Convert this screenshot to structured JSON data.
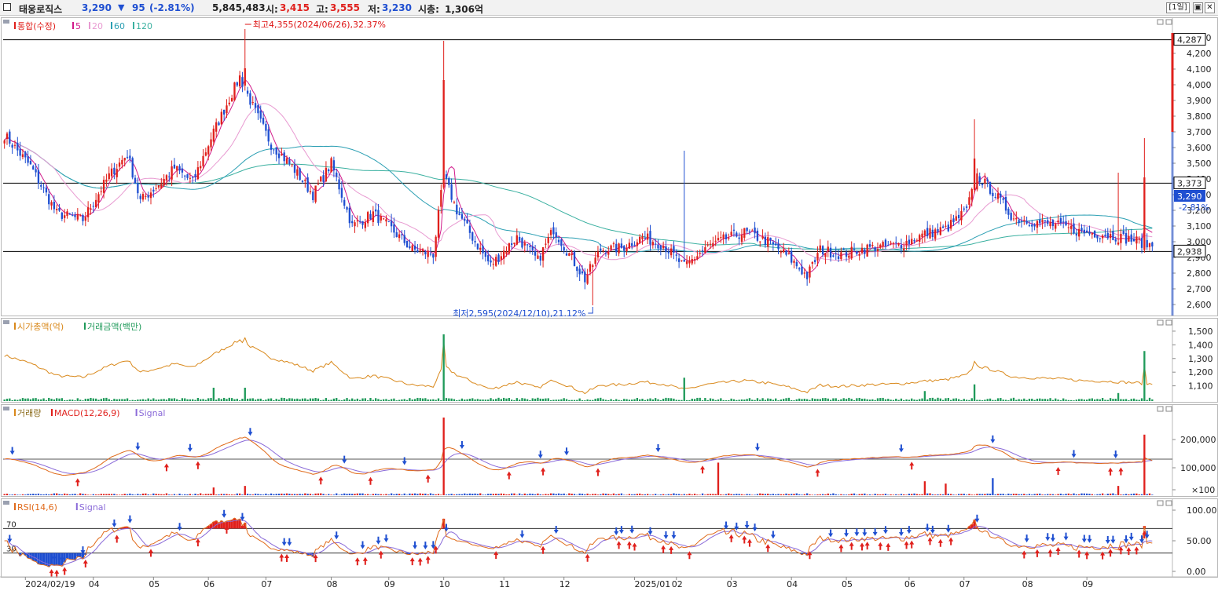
{
  "header": {
    "stock_name": "태웅로직스",
    "price": "3,290",
    "change_arrow": "▼",
    "change": "95",
    "change_pct": "(-2.81%)",
    "volume": "5,845,483",
    "open_label": "시:",
    "open": "3,415",
    "high_label": "고:",
    "high": "3,555",
    "low_label": "저:",
    "low": "3,230",
    "mcap_label": "시총:",
    "mcap": "1,306억",
    "period_button": "[1일]",
    "restore_icon": "restore-icon",
    "close_icon": "close-icon"
  },
  "colors": {
    "up": "#e0201c",
    "down": "#1f4fd1",
    "ma5": "#d11a8a",
    "ma20": "#e89ad1",
    "ma60": "#2b9fb3",
    "ma120": "#3ab0a0",
    "macd": "#e06a1a",
    "signal": "#8a6ad8",
    "rsi": "#e06a1a",
    "mcap_line": "#d9881a",
    "tv_bar": "#1f9a5a"
  },
  "chart_data": [
    {
      "type": "candlestick",
      "panel": "price",
      "legend": [
        "통합(수정)",
        "5",
        "20",
        "60",
        "120"
      ],
      "y_ticks": [
        "4,300",
        "4,200",
        "4,100",
        "4,000",
        "3,900",
        "3,800",
        "3,700",
        "3,600",
        "3,500",
        "3,400",
        "3,300",
        "3,200",
        "3,100",
        "3,000",
        "2,900",
        "2,800",
        "2,700",
        "2,600"
      ],
      "ylim": [
        2530,
        4430
      ],
      "hlines": [
        {
          "value": 4287,
          "label": "4,287"
        },
        {
          "value": 3373,
          "label": "3,373"
        },
        {
          "value": 2938,
          "label": "2,938"
        }
      ],
      "current": {
        "value": 3290,
        "label": "3,290",
        "change": "-2.81%"
      },
      "annotations": [
        {
          "text": "최고4,355(2024/06/26),32.37%",
          "value": 4355
        },
        {
          "text": "최저2,595(2024/12/10),21.12%",
          "value": 2595
        }
      ],
      "anchors": [
        [
          0,
          3680
        ],
        [
          10,
          3480
        ],
        [
          20,
          3180
        ],
        [
          30,
          3140
        ],
        [
          40,
          3420
        ],
        [
          47,
          3560
        ],
        [
          52,
          3260
        ],
        [
          60,
          3380
        ],
        [
          65,
          3470
        ],
        [
          72,
          3380
        ],
        [
          80,
          3700
        ],
        [
          90,
          4050
        ],
        [
          95,
          3860
        ],
        [
          102,
          3620
        ],
        [
          110,
          3480
        ],
        [
          118,
          3300
        ],
        [
          125,
          3500
        ],
        [
          133,
          3100
        ],
        [
          141,
          3180
        ],
        [
          148,
          3080
        ],
        [
          156,
          2950
        ],
        [
          164,
          2920
        ],
        [
          168,
          3420
        ],
        [
          173,
          3200
        ],
        [
          180,
          3000
        ],
        [
          186,
          2850
        ],
        [
          196,
          3030
        ],
        [
          204,
          2880
        ],
        [
          210,
          3080
        ],
        [
          216,
          2920
        ],
        [
          222,
          2760
        ],
        [
          228,
          2950
        ],
        [
          236,
          2960
        ],
        [
          244,
          3030
        ],
        [
          252,
          2980
        ],
        [
          260,
          2840
        ],
        [
          268,
          2960
        ],
        [
          276,
          3020
        ],
        [
          283,
          3060
        ],
        [
          292,
          3000
        ],
        [
          300,
          2900
        ],
        [
          307,
          2780
        ],
        [
          312,
          2950
        ],
        [
          320,
          2920
        ],
        [
          330,
          2960
        ],
        [
          338,
          2970
        ],
        [
          344,
          2990
        ],
        [
          352,
          3050
        ],
        [
          360,
          3080
        ],
        [
          368,
          3200
        ],
        [
          372,
          3420
        ],
        [
          378,
          3320
        ],
        [
          386,
          3150
        ],
        [
          396,
          3120
        ],
        [
          404,
          3100
        ],
        [
          412,
          3060
        ],
        [
          420,
          3050
        ],
        [
          432,
          3010
        ],
        [
          440,
          2970
        ]
      ],
      "spikes": [
        {
          "i": 168,
          "hi": 4280
        },
        {
          "i": 260,
          "hi": 3580
        },
        {
          "i": 92,
          "hi": 4355
        },
        {
          "i": 225,
          "lo": 2595
        },
        {
          "i": 371,
          "hi": 3780
        },
        {
          "i": 426,
          "hi": 3440
        },
        {
          "i": 436,
          "hi": 3660
        }
      ]
    },
    {
      "type": "line",
      "panel": "market_cap_and_trading_value",
      "legend": [
        "시가총액(억)",
        "거래금액(백만)"
      ],
      "y_ticks": [
        "1,500",
        "1,400",
        "1,300",
        "1,200",
        "1,100"
      ],
      "ylim": [
        1000,
        1580
      ],
      "tv_spikes": [
        {
          "i": 168,
          "v": 1.0
        },
        {
          "i": 260,
          "v": 0.35
        },
        {
          "i": 80,
          "v": 0.2
        },
        {
          "i": 92,
          "v": 0.2
        },
        {
          "i": 352,
          "v": 0.15
        },
        {
          "i": 371,
          "v": 0.25
        },
        {
          "i": 426,
          "v": 0.12
        },
        {
          "i": 436,
          "v": 0.75
        }
      ]
    },
    {
      "type": "line",
      "panel": "volume_macd",
      "legend": [
        "거래량",
        "MACD(12,26,9)",
        "Signal"
      ],
      "y_ticks": [
        "200,000",
        "100,000",
        "×100"
      ],
      "hline": 0,
      "vol_spikes": [
        {
          "i": 168,
          "v": 1.0
        },
        {
          "i": 273,
          "v": 0.42
        },
        {
          "i": 436,
          "v": 0.78
        },
        {
          "i": 378,
          "v": 0.22
        },
        {
          "i": 352,
          "v": 0.18
        },
        {
          "i": 360,
          "v": 0.15
        },
        {
          "i": 426,
          "v": 0.12
        },
        {
          "i": 80,
          "v": 0.1
        },
        {
          "i": 92,
          "v": 0.12
        }
      ]
    },
    {
      "type": "line",
      "panel": "rsi",
      "legend": [
        "RSI(14,6)",
        "Signal"
      ],
      "y_ticks": [
        "100.00",
        "50.00",
        "0.00"
      ],
      "levels": [
        {
          "value": 70,
          "label": "70"
        },
        {
          "value": 30,
          "label": "30"
        }
      ],
      "ylim": [
        0,
        100
      ]
    }
  ],
  "x_axis": {
    "count": 440,
    "labels": [
      {
        "i": 8,
        "text": "2024/02/19"
      },
      {
        "i": 34,
        "text": "04"
      },
      {
        "i": 57,
        "text": "05"
      },
      {
        "i": 78,
        "text": "06"
      },
      {
        "i": 100,
        "text": "07"
      },
      {
        "i": 125,
        "text": "08"
      },
      {
        "i": 147,
        "text": "09"
      },
      {
        "i": 168,
        "text": "10"
      },
      {
        "i": 191,
        "text": "11"
      },
      {
        "i": 214,
        "text": "12"
      },
      {
        "i": 241,
        "text": "2025/01"
      },
      {
        "i": 257,
        "text": "02"
      },
      {
        "i": 278,
        "text": "03"
      },
      {
        "i": 301,
        "text": "04"
      },
      {
        "i": 322,
        "text": "05"
      },
      {
        "i": 346,
        "text": "06"
      },
      {
        "i": 367,
        "text": "07"
      },
      {
        "i": 391,
        "text": "08"
      },
      {
        "i": 414,
        "text": "09"
      }
    ]
  }
}
